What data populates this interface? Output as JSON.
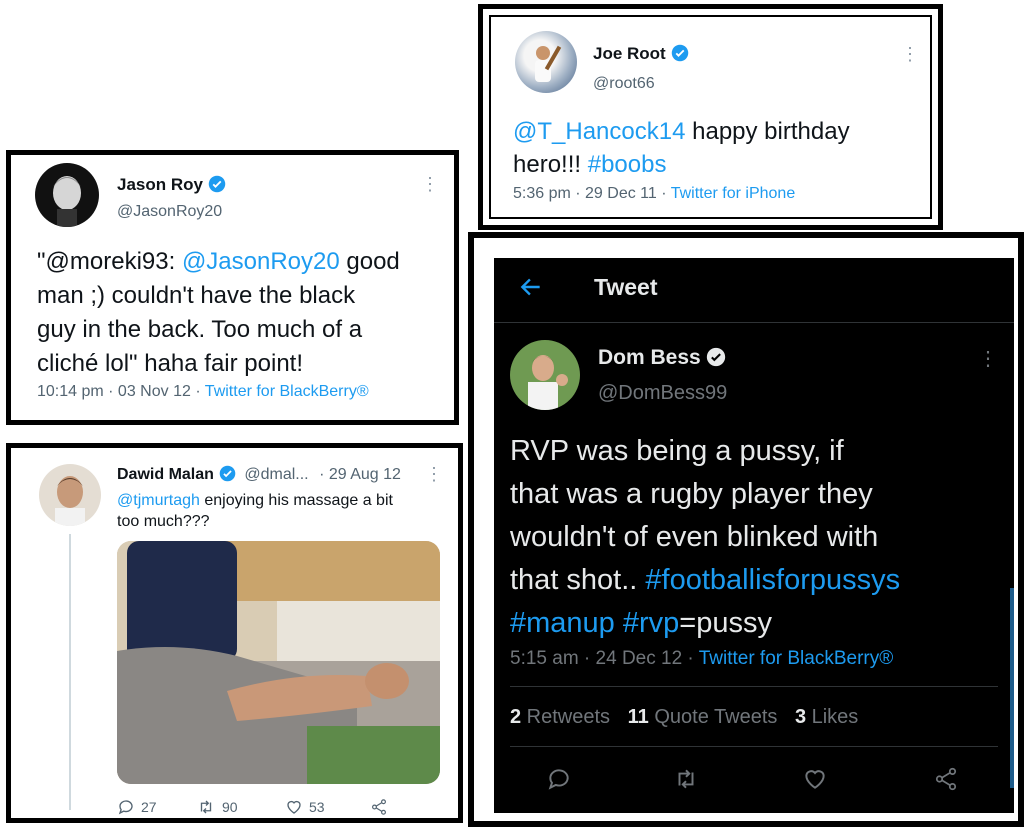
{
  "root": {
    "name": "Joe Root",
    "handle": "@root66",
    "body_mention": "@T_Hancock14",
    "body_line1_rest": " happy birthday",
    "body_line2_text": "hero!!! ",
    "body_hashtag": "#boobs",
    "timestamp": "5:36 pm · 29 Dec 11 · ",
    "client": "Twitter for iPhone"
  },
  "roy": {
    "name": "Jason Roy",
    "handle": "@JasonRoy20",
    "line1_start": "\"@moreki93: ",
    "line1_mention": "@JasonRoy20",
    "line1_end": " good",
    "line2": "man ;) couldn't have the black",
    "line3": "guy in the back. Too much of a",
    "line4": "cliché lol\" haha fair point!",
    "timestamp": "10:14 pm · 03 Nov 12 · ",
    "client": "Twitter for BlackBerry®"
  },
  "malan": {
    "name": "Dawid Malan",
    "handle": "@dmal...",
    "date": "· 29 Aug 12",
    "mention": "@tjmurtagh",
    "line1_rest": " enjoying his massage a bit",
    "line2": "too much???",
    "replies": "27",
    "retweets": "90",
    "likes": "53"
  },
  "bess": {
    "header_title": "Tweet",
    "name": "Dom Bess",
    "handle": "@DomBess99",
    "line1": "RVP was being a pussy, if",
    "line2": "that was a rugby player they",
    "line3": "wouldn't of even blinked with",
    "line4_text": "that shot.. ",
    "line4_hashtag": "#footballisforpussys",
    "line5_hashtag1": "#manup",
    "line5_hashtag2": "#rvp",
    "line5_rest": "=pussy",
    "timestamp": "5:15 am · 24 Dec 12 · ",
    "client": "Twitter for BlackBerry®",
    "retweets_count": "2",
    "retweets_label": " Retweets",
    "quotes_count": "11",
    "quotes_label": " Quote Tweets",
    "likes_count": "3",
    "likes_label": " Likes"
  },
  "colors": {
    "link": "#1d9bf0",
    "verified": "#1d9bf0",
    "dark_bg": "#000000",
    "muted": "#536471"
  }
}
